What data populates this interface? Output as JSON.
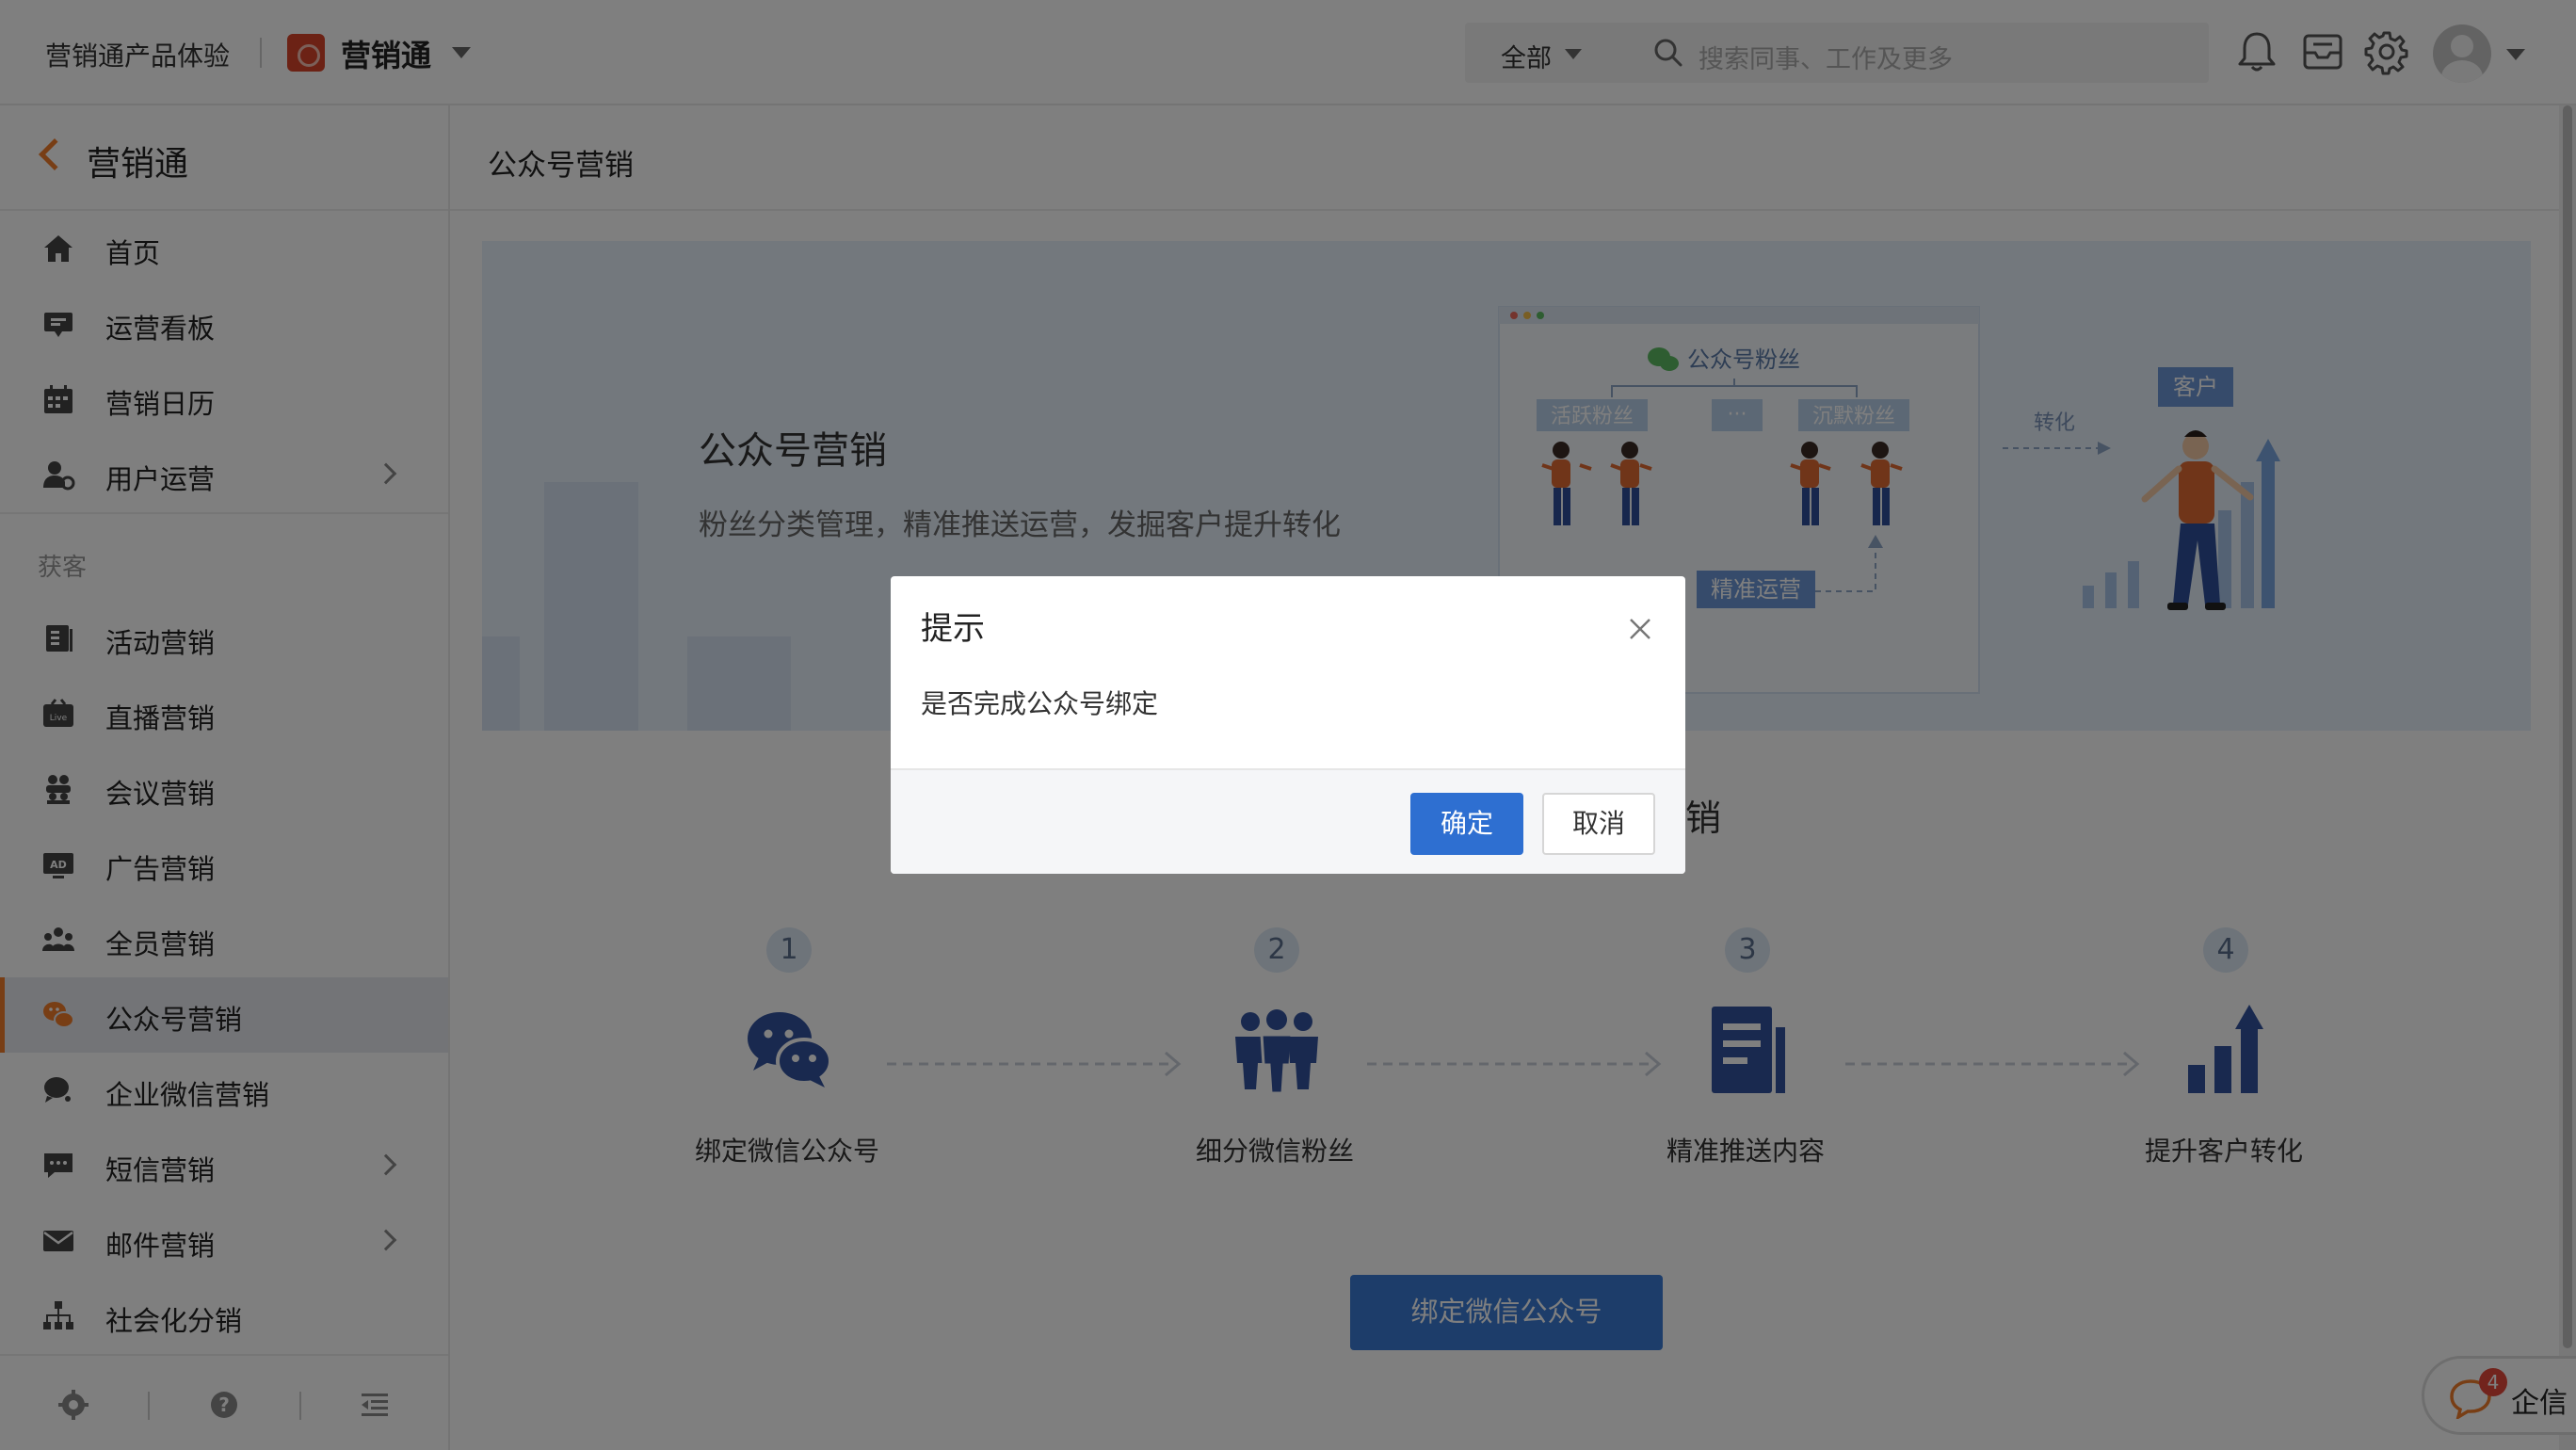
{
  "topbar": {
    "product_name": "营销通产品体验",
    "app_name": "营销通",
    "search_scope": "全部",
    "search_placeholder": "搜索同事、工作及更多",
    "icons": [
      "bell-icon",
      "inbox-icon",
      "gear-icon",
      "avatar"
    ]
  },
  "sidebar": {
    "title": "营销通",
    "items_top": [
      {
        "label": "首页",
        "icon": "home-icon"
      },
      {
        "label": "运营看板",
        "icon": "dashboard-icon"
      },
      {
        "label": "营销日历",
        "icon": "calendar-icon"
      },
      {
        "label": "用户运营",
        "icon": "user-ops-icon",
        "has_children": true
      }
    ],
    "section_label": "获客",
    "items": [
      {
        "label": "活动营销",
        "icon": "event-icon"
      },
      {
        "label": "直播营销",
        "icon": "live-icon"
      },
      {
        "label": "会议营销",
        "icon": "meeting-icon"
      },
      {
        "label": "广告营销",
        "icon": "ad-icon"
      },
      {
        "label": "全员营销",
        "icon": "team-icon"
      },
      {
        "label": "公众号营销",
        "icon": "wechat-official-icon",
        "active": true
      },
      {
        "label": "企业微信营销",
        "icon": "wecom-icon"
      },
      {
        "label": "短信营销",
        "icon": "sms-icon",
        "has_children": true
      },
      {
        "label": "邮件营销",
        "icon": "mail-icon",
        "has_children": true
      },
      {
        "label": "社会化分销",
        "icon": "org-icon"
      }
    ]
  },
  "main": {
    "title": "公众号营销",
    "banner": {
      "title": "公众号营销",
      "subtitle": "粉丝分类管理，精准推送运营，发掘客户提升转化",
      "illustration": {
        "box_title": "公众号粉丝",
        "tag_active": "活跃粉丝",
        "tag_more": "···",
        "tag_silent": "沉默粉丝",
        "tag_push": "精准运营",
        "arrow_label": "转化",
        "customer_label": "客户"
      }
    },
    "flow_title_visible": "销",
    "steps": [
      {
        "num": "1",
        "label": "绑定微信公众号",
        "icon": "wechat-icon"
      },
      {
        "num": "2",
        "label": "细分微信粉丝",
        "icon": "group-icon"
      },
      {
        "num": "3",
        "label": "精准推送内容",
        "icon": "document-icon"
      },
      {
        "num": "4",
        "label": "提升客户转化",
        "icon": "growth-chart-icon"
      }
    ],
    "bind_button": "绑定微信公众号"
  },
  "qixin": {
    "label": "企信",
    "badge": "4"
  },
  "modal": {
    "title": "提示",
    "message": "是否完成公众号绑定",
    "ok": "确定",
    "cancel": "取消"
  },
  "colors": {
    "accent": "#f07c2b",
    "primary": "#2e6fd1",
    "banner_bg": "#e6f0fb",
    "icon_blue": "#33539e"
  }
}
